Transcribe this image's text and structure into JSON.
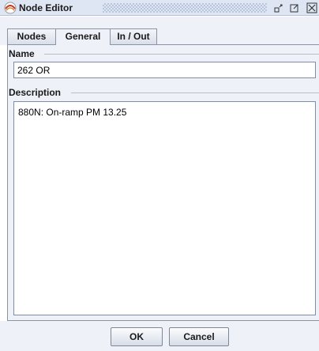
{
  "window": {
    "title": "Node Editor"
  },
  "tabs": [
    {
      "label": "Nodes"
    },
    {
      "label": "General",
      "active": true
    },
    {
      "label": "In / Out"
    }
  ],
  "name_section": {
    "label": "Name",
    "value": "262 OR"
  },
  "description_section": {
    "label": "Description",
    "value": "880N: On-ramp PM 13.25"
  },
  "buttons": {
    "ok": "OK",
    "cancel": "Cancel"
  },
  "icons": {
    "app": "node-editor-app-icon",
    "minimize": "minimize-icon",
    "maximize": "maximize-icon",
    "close": "close-icon"
  },
  "colors": {
    "titlebar": "#dfe6f3",
    "panel": "#eef1f7",
    "border": "#8a94a6"
  }
}
